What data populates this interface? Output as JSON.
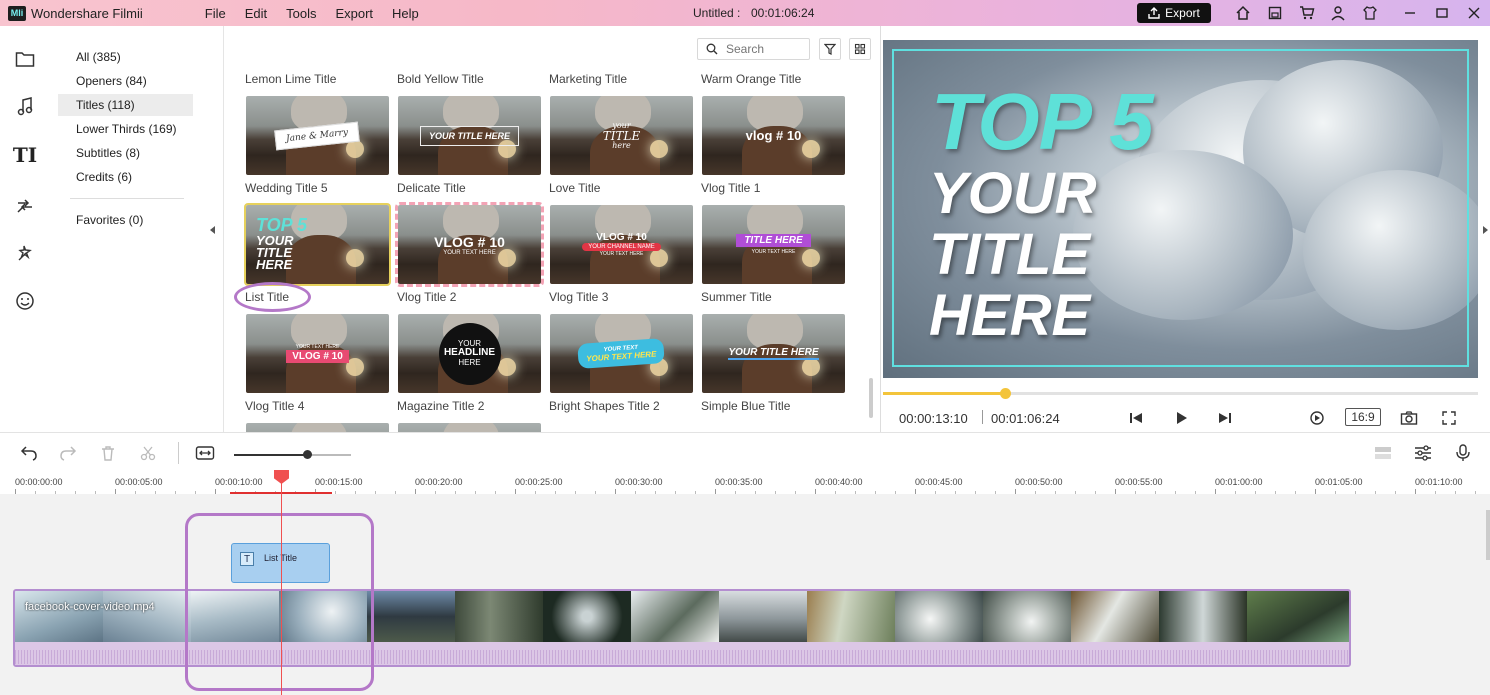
{
  "app": {
    "logo_text": "Mli",
    "name": "Wondershare Filmii",
    "menu": [
      "File",
      "Edit",
      "Tools",
      "Export",
      "Help"
    ],
    "document_title": "Untitled :",
    "document_time": "00:01:06:24",
    "export_label": "Export"
  },
  "sidebar_icons": [
    "folder-icon",
    "music-icon",
    "titles-icon",
    "transitions-icon",
    "effects-icon",
    "elements-icon"
  ],
  "titles_icon_text": "TI",
  "categories": [
    {
      "label": "All (385)"
    },
    {
      "label": "Openers (84)"
    },
    {
      "label": "Titles (118)"
    },
    {
      "label": "Lower Thirds (169)"
    },
    {
      "label": "Subtitles (8)"
    },
    {
      "label": "Credits (6)"
    }
  ],
  "favorites": "Favorites (0)",
  "library": {
    "search_placeholder": "Search",
    "row0_labels": [
      "Lemon Lime Title",
      "Bold Yellow Title",
      "Marketing Title",
      "Warm Orange Title"
    ],
    "items": [
      {
        "label": "Wedding Title 5",
        "overlay": [
          "Jane & Marry"
        ]
      },
      {
        "label": "Delicate Title",
        "overlay": [
          "YOUR TITLE HERE"
        ]
      },
      {
        "label": "Love Title",
        "overlay": [
          "your",
          "TITLE",
          "here"
        ]
      },
      {
        "label": "Vlog Title 1",
        "overlay": [
          "vlog # 10"
        ]
      },
      {
        "label": "List Title",
        "overlay": [
          "TOP 5",
          "YOUR",
          "TITLE",
          "HERE"
        ]
      },
      {
        "label": "Vlog Title 2",
        "overlay": [
          "VLOG # 10",
          "YOUR TEXT HERE"
        ]
      },
      {
        "label": "Vlog Title 3",
        "overlay": [
          "VLOG # 10",
          "YOUR CHANNEL NAME",
          "YOUR TEXT HERE"
        ]
      },
      {
        "label": "Summer Title",
        "overlay": [
          "TITLE HERE",
          "YOUR TEXT HERE"
        ]
      },
      {
        "label": "Vlog Title 4",
        "overlay": [
          "YOUR TEXT HERE",
          "VLOG # 10"
        ]
      },
      {
        "label": "Magazine Title 2",
        "overlay": [
          "YOUR",
          "HEADLINE",
          "HERE"
        ]
      },
      {
        "label": "Bright Shapes Title 2",
        "overlay": [
          "YOUR TEXT",
          "YOUR TEXT HERE"
        ]
      },
      {
        "label": "Simple Blue Title",
        "overlay": [
          "YOUR TITLE HERE"
        ]
      }
    ]
  },
  "preview": {
    "line1": "TOP 5",
    "line2": "YOUR",
    "line3": "TITLE",
    "line4": "HERE",
    "current_time": "00:00:13:10",
    "total_time": "00:01:06:24",
    "progress": 0.205,
    "aspect_ratio": "16:9"
  },
  "toolbar": {
    "zoom_level": 0.62
  },
  "timeline": {
    "ticks": [
      "00:00:00:00",
      "00:00:05:00",
      "00:00:10:00",
      "00:00:15:00",
      "00:00:20:00",
      "00:00:25:00",
      "00:00:30:00",
      "00:00:35:00",
      "00:00:40:00",
      "00:00:45:00",
      "00:00:50:00",
      "00:00:55:00",
      "00:01:00:00",
      "00:01:05:00",
      "00:01:10:00"
    ],
    "title_clip": "List Title",
    "title_clip_icon": "T",
    "video_clip": "facebook-cover-video.mp4"
  },
  "colors": {
    "accent_yellow": "#f3c43b",
    "annotation_purple": "#b478c8",
    "title_cyan": "#5ee1d8",
    "playhead_red": "#f05050"
  }
}
